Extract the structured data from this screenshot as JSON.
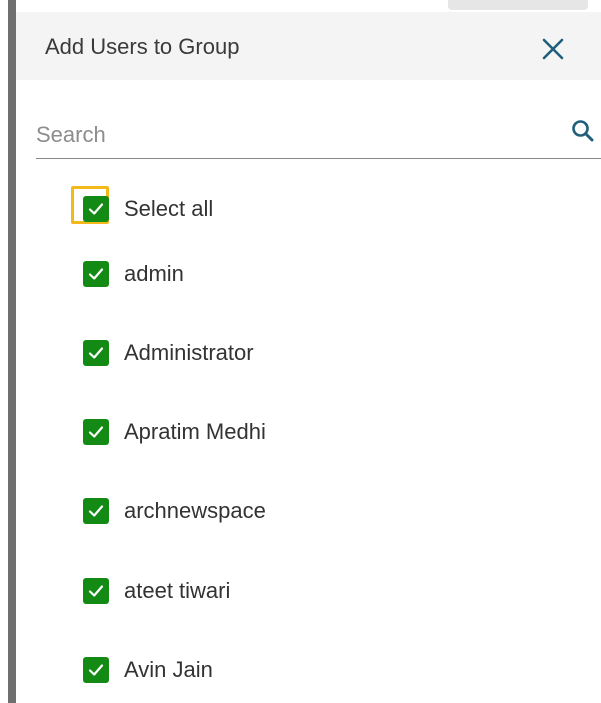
{
  "dialog": {
    "title": "Add Users to Group",
    "close_icon": "close-icon"
  },
  "search": {
    "placeholder": "Search",
    "value": "",
    "icon": "search-icon"
  },
  "select_all": {
    "label": "Select all",
    "checked": true
  },
  "users": [
    {
      "label": "admin",
      "checked": true
    },
    {
      "label": "Administrator",
      "checked": true
    },
    {
      "label": "Apratim Medhi",
      "checked": true
    },
    {
      "label": "archnewspace",
      "checked": true
    },
    {
      "label": "ateet tiwari",
      "checked": true
    },
    {
      "label": "Avin Jain",
      "checked": true
    }
  ],
  "colors": {
    "checkbox_checked": "#138a13",
    "focus_ring": "#f3b81a",
    "accent_icon": "#1f5f7a",
    "header_bg": "#f4f4f4"
  }
}
